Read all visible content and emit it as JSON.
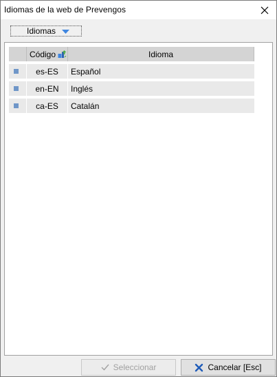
{
  "window": {
    "title": "Idiomas de la web de Prevengos"
  },
  "toolbar": {
    "menu_label": "Idiomas"
  },
  "grid": {
    "columns": {
      "code": "Código",
      "language": "Idioma"
    },
    "rows": [
      {
        "code": "es-ES",
        "language": "Español"
      },
      {
        "code": "en-EN",
        "language": "Inglés"
      },
      {
        "code": "ca-ES",
        "language": "Catalán"
      }
    ]
  },
  "footer": {
    "select_label": "Seleccionar",
    "cancel_label": "Cancelar [Esc]"
  },
  "colors": {
    "marker": "#6f96c8",
    "cancel_icon": "#1e5bb8",
    "dropdown_arrow": "#3f86e0"
  }
}
